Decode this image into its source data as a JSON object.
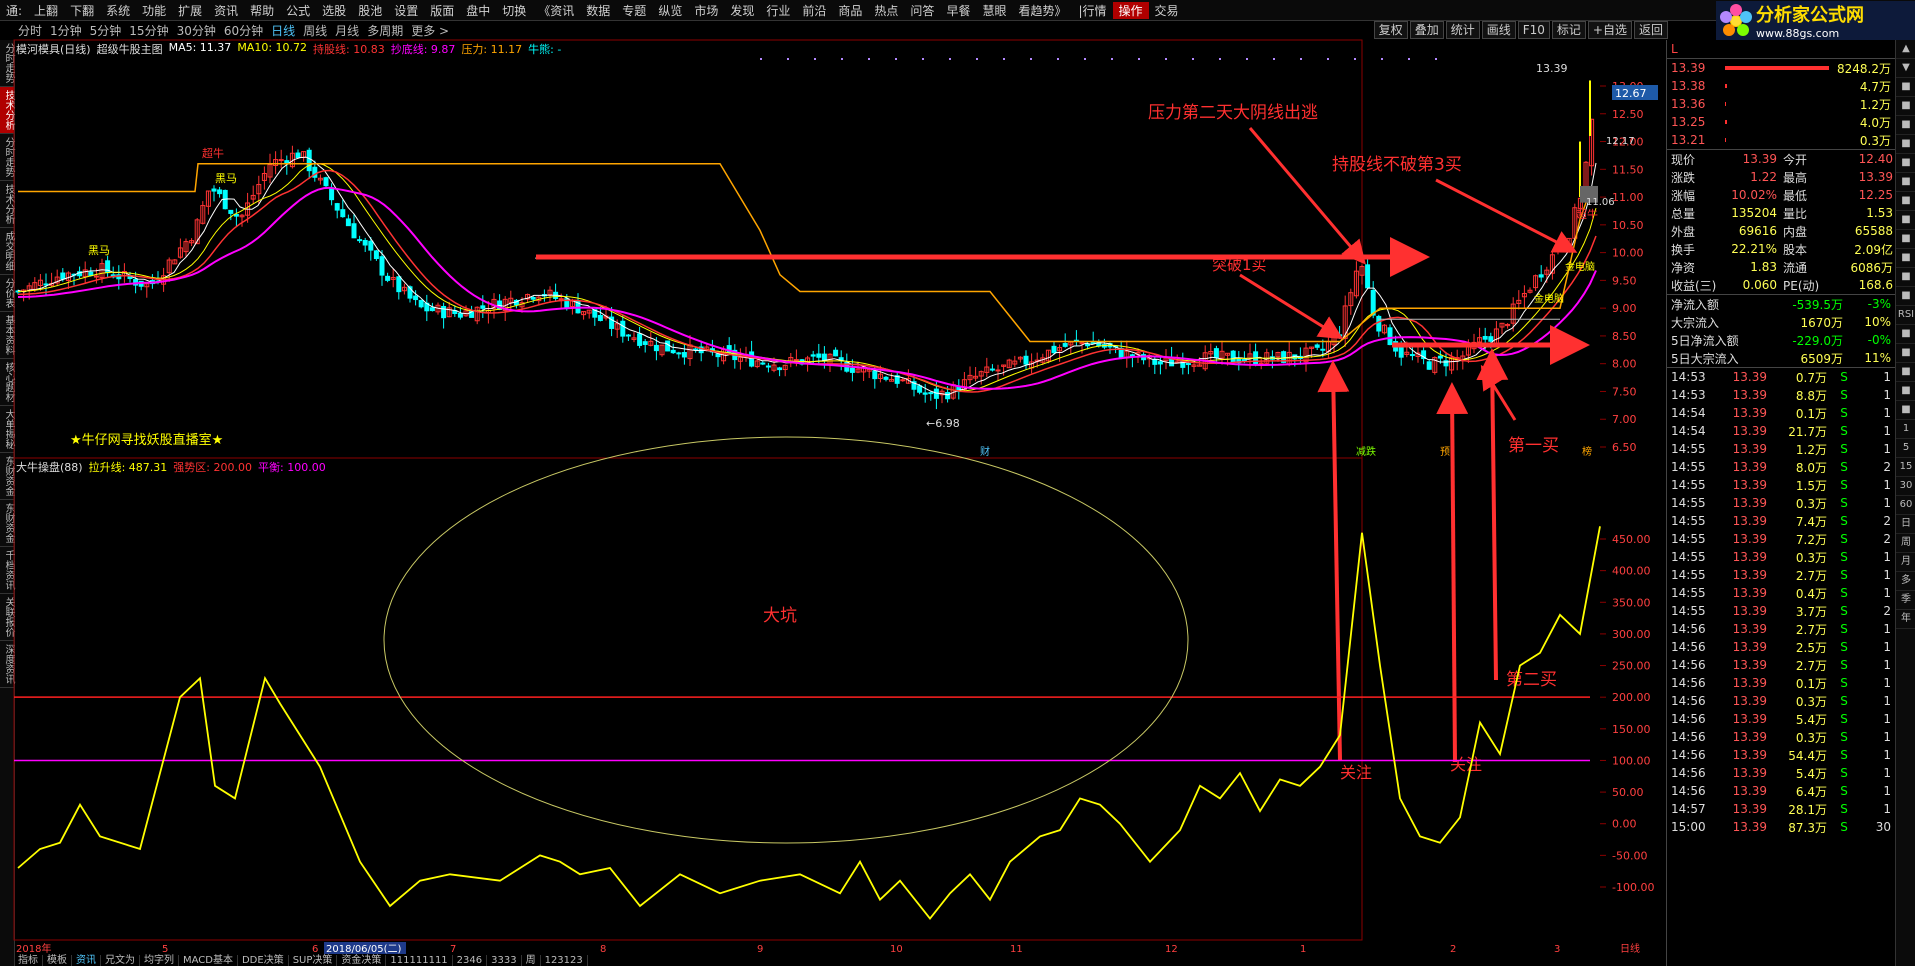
{
  "menu": [
    "通:",
    "上翻",
    "下翻",
    "系统",
    "功能",
    "扩展",
    "资讯",
    "帮助",
    "公式",
    "选股",
    "股池",
    "设置",
    "版面",
    "盘中",
    "切换",
    "《资讯",
    "数据",
    "专题",
    "纵览",
    "市场",
    "发现",
    "行业",
    "前沿",
    "商品",
    "热点",
    "问答",
    "早餐",
    "慧眼",
    "看趋势》",
    "|行情",
    "操作",
    "交易"
  ],
  "menu_active": "操作",
  "logo": {
    "text": "分析家公式网",
    "url_text": "www.88gs.com"
  },
  "periods": [
    "分时",
    "1分钟",
    "5分钟",
    "15分钟",
    "30分钟",
    "60分钟",
    "日线",
    "周线",
    "月线",
    "多周期",
    "更多 >"
  ],
  "period_active": "日线",
  "right_tools": [
    "复权",
    "叠加",
    "统计",
    "画线",
    "F10",
    "标记",
    "+自选",
    "返回"
  ],
  "left_tabs": [
    "分时走势",
    "技术分析",
    "分时走势",
    "技术分析",
    "成交明细",
    "分价表",
    "基本资料",
    "核心题材",
    "大单揭秘",
    "东财资金",
    "东财资金",
    "千档资讯",
    "关联报价",
    "深度资讯"
  ],
  "left_tab_active_index": 1,
  "chart_info": {
    "name": "模河模具(日线)",
    "indicator": "超级牛股主图",
    "ma5": "MA5: 11.37",
    "ma10": "MA10: 10.72",
    "hold": "持股线: 10.83",
    "bottom": "抄底线: 9.87",
    "pressure": "压力: 11.17",
    "bull": "牛熊: -"
  },
  "ind_info": {
    "name": "大牛操盘(88)",
    "lift": "拉升线: 487.31",
    "strong": "强势区: 200.00",
    "balance": "平衡: 100.00"
  },
  "colors": {
    "up": "#ff3333",
    "down": "#00ffff",
    "yellow": "#ffff00",
    "magenta": "#ff00ff",
    "orange": "#ffa500",
    "white": "#ffffff",
    "annot": "#ff3030",
    "ellipse": "#c8c864"
  },
  "annotations": {
    "a1": "压力第二天大阴线出逃",
    "a2": "持股线不破第3买",
    "a3": "突破1买",
    "a4": "第一买",
    "a5": "第二买",
    "a6": "大坑",
    "a7": "关注",
    "a8": "关注",
    "a9": "★牛仔网寻找妖股直播室★",
    "a10": "超牛",
    "a11": "黑马",
    "a12": "黑马",
    "a13": "超牛",
    "a14": "金电脑",
    "a15": "金电脑",
    "a16": "减跌",
    "a17": "预",
    "a18": "财",
    "a19": "榜"
  },
  "price_labels": {
    "high": "13.39",
    "low": "←6.98",
    "right_current": "12.67",
    "right_1": "12.17",
    "right_2": "11.06"
  },
  "price_axis": [
    "13.00",
    "12.50",
    "12.00",
    "11.50",
    "11.00",
    "10.50",
    "10.00",
    "9.50",
    "9.00",
    "8.50",
    "8.00",
    "7.50",
    "7.00",
    "6.50"
  ],
  "ind_axis": [
    "450.00",
    "400.00",
    "350.00",
    "300.00",
    "250.00",
    "200.00",
    "150.00",
    "100.00",
    "50.00",
    "0.00",
    "-50.00",
    "-100.00"
  ],
  "dates": [
    "2018年",
    "5",
    "6",
    "2018/06/05(二)",
    "7",
    "8",
    "9",
    "10",
    "11",
    "12",
    "1",
    "2",
    "3",
    "日线"
  ],
  "bottom_tabs": [
    "指标",
    "模板",
    "资讯",
    "兄文为",
    "均字列",
    "MACD基本",
    "DDE决策",
    "SUP决策",
    "资金决策",
    "111111111",
    "2346",
    "3333",
    "周",
    "123123"
  ],
  "bottom_tab_active": "资讯",
  "rp_title": "L",
  "orderbook": [
    {
      "p": "13.39",
      "v": "8248.2万",
      "bar": 1.0
    },
    {
      "p": "13.38",
      "v": "4.7万",
      "bar": 0.02
    },
    {
      "p": "13.36",
      "v": "1.2万",
      "bar": 0.01
    },
    {
      "p": "13.25",
      "v": "4.0万",
      "bar": 0.02
    },
    {
      "p": "13.21",
      "v": "0.3万",
      "bar": 0.01
    }
  ],
  "quotes": [
    [
      "现价",
      "13.39",
      "今开",
      "12.40"
    ],
    [
      "涨跌",
      "1.22",
      "最高",
      "13.39"
    ],
    [
      "涨幅",
      "10.02%",
      "最低",
      "12.25"
    ],
    [
      "总量",
      "135204",
      "量比",
      "1.53"
    ],
    [
      "外盘",
      "69616",
      "内盘",
      "65588"
    ],
    [
      "换手",
      "22.21%",
      "股本",
      "2.09亿"
    ],
    [
      "净资",
      "1.83",
      "流通",
      "6086万"
    ],
    [
      "收益(三)",
      "0.060",
      "PE(动)",
      "168.6"
    ]
  ],
  "flows": [
    [
      "净流入额",
      "-539.5万",
      "-3%"
    ],
    [
      "大宗流入",
      "1670万",
      "10%"
    ],
    [
      "5日净流入额",
      "-229.0万",
      "-0%"
    ],
    [
      "5日大宗流入",
      "6509万",
      "11%"
    ]
  ],
  "ticks": [
    [
      "14:53",
      "13.39",
      "0.7万",
      "S",
      "1"
    ],
    [
      "14:53",
      "13.39",
      "8.8万",
      "S",
      "1"
    ],
    [
      "14:54",
      "13.39",
      "0.1万",
      "S",
      "1"
    ],
    [
      "14:54",
      "13.39",
      "21.7万",
      "S",
      "1"
    ],
    [
      "14:55",
      "13.39",
      "1.2万",
      "S",
      "1"
    ],
    [
      "14:55",
      "13.39",
      "8.0万",
      "S",
      "2"
    ],
    [
      "14:55",
      "13.39",
      "1.5万",
      "S",
      "1"
    ],
    [
      "14:55",
      "13.39",
      "0.3万",
      "S",
      "1"
    ],
    [
      "14:55",
      "13.39",
      "7.4万",
      "S",
      "2"
    ],
    [
      "14:55",
      "13.39",
      "7.2万",
      "S",
      "2"
    ],
    [
      "14:55",
      "13.39",
      "0.3万",
      "S",
      "1"
    ],
    [
      "14:55",
      "13.39",
      "2.7万",
      "S",
      "1"
    ],
    [
      "14:55",
      "13.39",
      "0.4万",
      "S",
      "1"
    ],
    [
      "14:55",
      "13.39",
      "3.7万",
      "S",
      "2"
    ],
    [
      "14:56",
      "13.39",
      "2.7万",
      "S",
      "1"
    ],
    [
      "14:56",
      "13.39",
      "2.5万",
      "S",
      "1"
    ],
    [
      "14:56",
      "13.39",
      "2.7万",
      "S",
      "1"
    ],
    [
      "14:56",
      "13.39",
      "0.1万",
      "S",
      "1"
    ],
    [
      "14:56",
      "13.39",
      "0.3万",
      "S",
      "1"
    ],
    [
      "14:56",
      "13.39",
      "5.4万",
      "S",
      "1"
    ],
    [
      "14:56",
      "13.39",
      "0.3万",
      "S",
      "1"
    ],
    [
      "14:56",
      "13.39",
      "54.4万",
      "S",
      "1"
    ],
    [
      "14:56",
      "13.39",
      "5.4万",
      "S",
      "1"
    ],
    [
      "14:56",
      "13.39",
      "6.4万",
      "S",
      "1"
    ],
    [
      "14:57",
      "13.39",
      "28.1万",
      "S",
      "1"
    ],
    [
      "15:00",
      "13.39",
      "87.3万",
      "S",
      "30"
    ]
  ],
  "vstrip": [
    "▲",
    "▼",
    "■",
    "■",
    "■",
    "■",
    "■",
    "■",
    "■",
    "■",
    "■",
    "■",
    "■",
    "■",
    "RSI",
    "■",
    "■",
    "■",
    "■",
    "■",
    "1",
    "5",
    "15",
    "30",
    "60",
    "日",
    "周",
    "月",
    "多",
    "季",
    "年"
  ]
}
